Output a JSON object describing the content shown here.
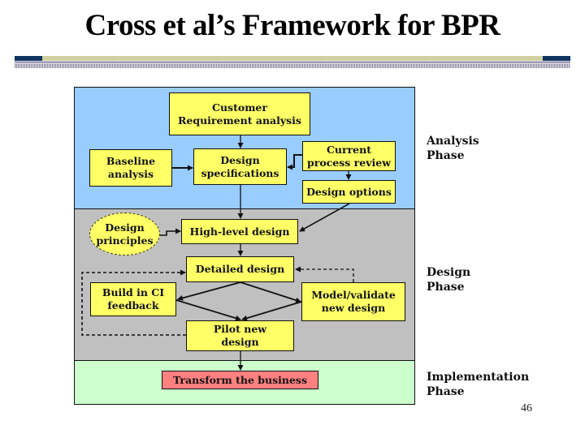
{
  "slide": {
    "title": "Cross et al’s Framework for BPR",
    "page_number": "46"
  },
  "phases": [
    {
      "id": "analysis",
      "label": "Analysis\nPhase",
      "color": "#99ccff"
    },
    {
      "id": "design",
      "label": "Design\nPhase",
      "color": "#c0c0c0"
    },
    {
      "id": "implementation",
      "label": "Implementation\nPhase",
      "color": "#ccffcc"
    }
  ],
  "nodes": {
    "customer_requirement": "Customer\nRequirement analysis",
    "baseline_analysis": "Baseline\nanalysis",
    "design_specifications": "Design\nspecifications",
    "current_process_review": "Current\nprocess review",
    "design_options": "Design options",
    "design_principles": "Design\nprinciples",
    "high_level_design": "High-level design",
    "detailed_design": "Detailed design",
    "build_in_ci_feedback": "Build in CI\nfeedback",
    "model_validate": "Model/validate\nnew design",
    "pilot_new_design": "Pilot new\ndesign",
    "transform_business": "Transform the business"
  },
  "colors": {
    "process_box": "#ffff66",
    "final_box": "#ff8080",
    "title_bar_dark": "#0e3460",
    "title_bar_tan": "#cfcf9f"
  },
  "edges": [
    {
      "from": "customer_requirement",
      "to": "design_specifications",
      "style": "solid"
    },
    {
      "from": "baseline_analysis",
      "to": "design_specifications",
      "style": "solid"
    },
    {
      "from": "current_process_review",
      "to": "design_specifications",
      "style": "solid"
    },
    {
      "from": "current_process_review",
      "to": "design_options",
      "style": "solid"
    },
    {
      "from": "design_specifications",
      "to": "high_level_design",
      "style": "solid"
    },
    {
      "from": "design_options",
      "to": "high_level_design",
      "style": "solid"
    },
    {
      "from": "design_principles",
      "to": "high_level_design",
      "style": "solid"
    },
    {
      "from": "high_level_design",
      "to": "detailed_design",
      "style": "solid"
    },
    {
      "from": "detailed_design",
      "to": "build_in_ci_feedback",
      "style": "solid"
    },
    {
      "from": "detailed_design",
      "to": "model_validate",
      "style": "solid"
    },
    {
      "from": "build_in_ci_feedback",
      "to": "pilot_new_design",
      "style": "solid"
    },
    {
      "from": "model_validate",
      "to": "pilot_new_design",
      "style": "solid"
    },
    {
      "from": "model_validate",
      "to": "detailed_design",
      "style": "dashed"
    },
    {
      "from": "pilot_new_design",
      "to": "detailed_design",
      "style": "dashed"
    },
    {
      "from": "pilot_new_design",
      "to": "transform_business",
      "style": "solid"
    }
  ]
}
